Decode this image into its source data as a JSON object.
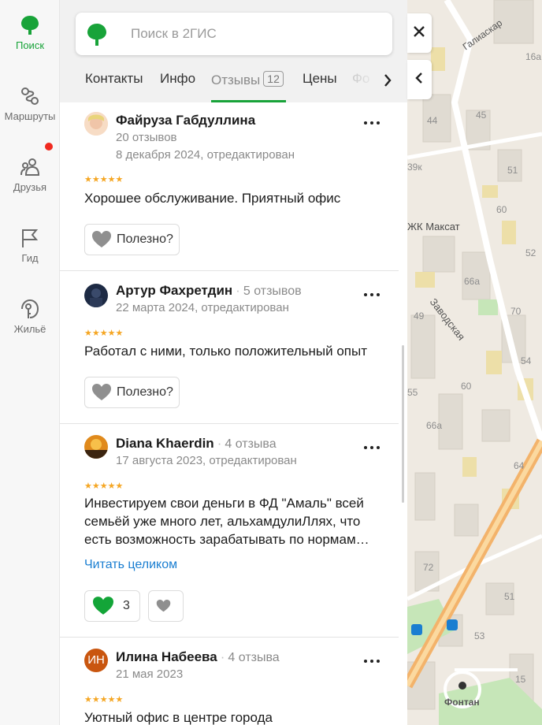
{
  "rail": {
    "items": [
      {
        "label": "Поиск",
        "icon": "leaf-logo-icon",
        "active": true
      },
      {
        "label": "Маршруты",
        "icon": "routes-icon"
      },
      {
        "label": "Друзья",
        "icon": "friends-icon"
      },
      {
        "label": "Гид",
        "icon": "flag-icon"
      },
      {
        "label": "Жильё",
        "icon": "house-key-icon"
      }
    ]
  },
  "search": {
    "placeholder": "Поиск в 2ГИС"
  },
  "tabs": {
    "items": [
      "Контакты",
      "Инфо",
      "Отзывы",
      "Цены",
      "Фо"
    ],
    "reviews_count": "12",
    "active": "Отзывы"
  },
  "reviews": [
    {
      "author": "Файруза Габдуллина",
      "count": "20 отзывов",
      "date": "8 декабря 2024, отредактирован",
      "stars": "★★★★★",
      "text": "Хорошее обслуживание. Приятный офис",
      "useful": "Полезно?"
    },
    {
      "author": "Артур Фахретдин",
      "count": "5 отзывов",
      "date": "22 марта 2024, отредактирован",
      "stars": "★★★★★",
      "text": "Работал с ними, только положительный опыт",
      "useful": "Полезно?"
    },
    {
      "author": "Diana Khaerdin",
      "count": "4 отзыва",
      "date": "17 августа 2023, отредактирован",
      "stars": "★★★★★",
      "text": "Инвестируем свои деньги в ФД \"Амаль\" всей семьёй уже много лет, альхамдулиЛлях, что есть возможность зарабатывать по нормам…",
      "read_more": "Читать целиком",
      "likes": "3"
    },
    {
      "author": "Илина Набеева",
      "count": "4 отзыва",
      "date": "21 мая 2023",
      "avatar_initials": "ИН",
      "stars": "★★★★★",
      "text": "Уютный офис в центре города"
    }
  ],
  "map": {
    "labels": [
      "Галиаскар",
      "16а",
      "45",
      "44",
      "51",
      "39к",
      "60",
      "ЖК Максат",
      "52",
      "66а",
      "70",
      "49",
      "Заводская",
      "54",
      "55",
      "60",
      "66а",
      "64",
      "72",
      "51",
      "53",
      "15",
      "Фонтан"
    ]
  },
  "colors": {
    "accent": "#18a339",
    "link": "#1a7ed1",
    "notification": "#f0291f",
    "map_road": "#f3b36b"
  }
}
